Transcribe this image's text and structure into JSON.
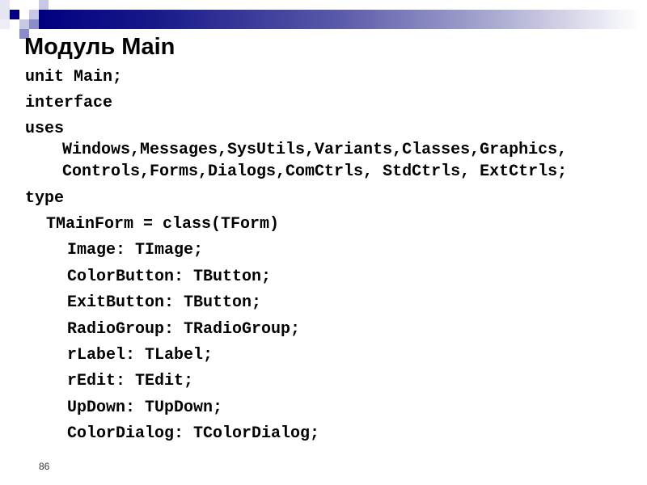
{
  "slide": {
    "title": "Модуль Main",
    "page_number": "86",
    "lines": [
      "unit Main;",
      "interface",
      "uses",
      "Windows,Messages,SysUtils,Variants,Classes,Graphics,",
      "Controls,Forms,Dialogs,ComCtrls, StdCtrls, ExtCtrls;",
      "type",
      "TMainForm = class(TForm)",
      "Image: TImage;",
      "ColorButton: TButton;",
      "ExitButton: TButton;",
      "RadioGroup: TRadioGroup;",
      "rLabel: TLabel;",
      "rEdit: TEdit;",
      "UpDown: TUpDown;",
      "ColorDialog: TColorDialog;"
    ]
  },
  "theme": {
    "header_bar_start": "#000080",
    "header_bar_end": "#ffffff",
    "square_dark": "#000080",
    "square_mid": "#8c8cc6",
    "square_light": "#c8c8e4"
  }
}
